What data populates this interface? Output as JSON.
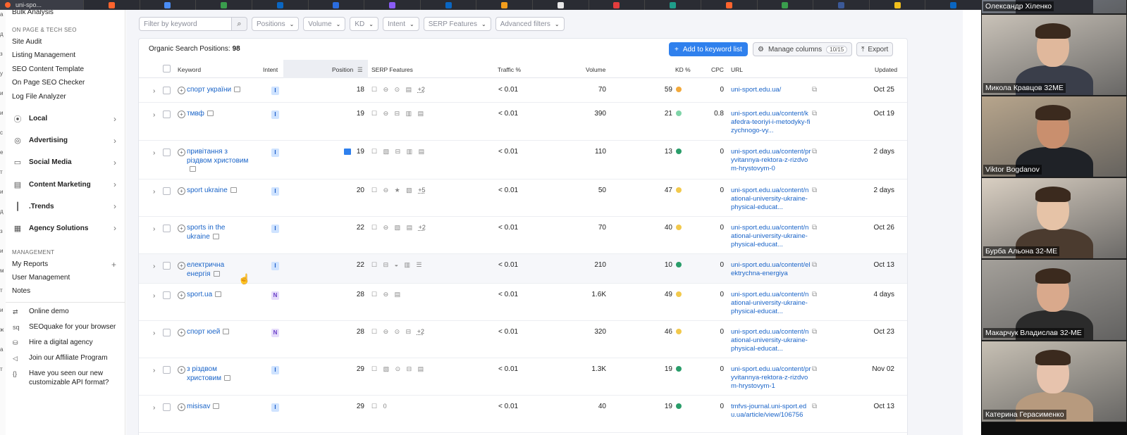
{
  "browser": {
    "active_tab_label": "uni-spo...",
    "tab_favicons": [
      {
        "icon": "generic-favicon-icon",
        "color": "#ff642d"
      },
      {
        "icon": "generic-favicon-icon",
        "color": "#4a8df6"
      },
      {
        "icon": "generic-favicon-icon",
        "color": "#3a9e4d"
      },
      {
        "icon": "linkedin-favicon-icon",
        "color": "#0a66c2"
      },
      {
        "icon": "generic-favicon-icon",
        "color": "#2b6de0"
      },
      {
        "icon": "generic-favicon-icon",
        "color": "#8a5cf6"
      },
      {
        "icon": "linkedin-favicon-icon",
        "color": "#0a66c2"
      },
      {
        "icon": "analytics-favicon-icon",
        "color": "#f29d1c"
      },
      {
        "icon": "generic-favicon-icon",
        "color": "#e8e8e8"
      },
      {
        "icon": "generic-favicon-icon",
        "color": "#e33d3d"
      },
      {
        "icon": "generic-favicon-icon",
        "color": "#1f9e8a"
      },
      {
        "icon": "generic-favicon-icon",
        "color": "#ff642d"
      },
      {
        "icon": "generic-favicon-icon",
        "color": "#3a9e4d"
      },
      {
        "icon": "generic-favicon-icon",
        "color": "#3b5998"
      },
      {
        "icon": "generic-favicon-icon",
        "color": "#f2c01c"
      },
      {
        "icon": "generic-favicon-icon",
        "color": "#0a66c2"
      }
    ]
  },
  "left_edge_glyphs": [
    "а",
    "д",
    "з",
    "у",
    "и",
    "и",
    "с",
    "е",
    "т",
    "и",
    "д",
    "з",
    "и",
    "м",
    "т",
    "и",
    "ж",
    "а",
    "т"
  ],
  "sidebar": {
    "top_link": "Bulk Analysis",
    "onpage_caption": "ON PAGE & TECH SEO",
    "onpage_links": [
      "Site Audit",
      "Listing Management",
      "SEO Content Template",
      "On Page SEO Checker",
      "Log File Analyzer"
    ],
    "sections": [
      {
        "label": "Local",
        "icon": "location-pin-icon"
      },
      {
        "label": "Advertising",
        "icon": "target-icon"
      },
      {
        "label": "Social Media",
        "icon": "chat-icon"
      },
      {
        "label": "Content Marketing",
        "icon": "document-icon"
      },
      {
        "label": ".Trends",
        "icon": "bar-chart-icon"
      },
      {
        "label": "Agency Solutions",
        "icon": "grid-icon"
      }
    ],
    "management_caption": "MANAGEMENT",
    "management_links": [
      "My Reports",
      "User Management",
      "Notes"
    ],
    "promos": [
      {
        "label": "Online demo",
        "icon": "demo-icon"
      },
      {
        "label": "SEOquake for your browser",
        "icon": "seoquake-icon"
      },
      {
        "label": "Hire a digital agency",
        "icon": "agency-icon"
      },
      {
        "label": "Join our Affiliate Program",
        "icon": "megaphone-icon"
      },
      {
        "label": "Have you seen our new customizable API format?",
        "icon": "api-braces-icon"
      }
    ]
  },
  "filters": {
    "search_placeholder": "Filter by keyword",
    "dropdowns": [
      "Positions",
      "Volume",
      "KD",
      "Intent",
      "SERP Features",
      "Advanced filters"
    ]
  },
  "panel": {
    "title": "Organic Search Positions:",
    "count": "98",
    "add_button": "Add to keyword list",
    "manage_columns": "Manage columns",
    "manage_columns_count": "10/15",
    "export": "Export"
  },
  "columns": [
    "Keyword",
    "Intent",
    "Position",
    "SERP Features",
    "Traffic %",
    "Volume",
    "KD %",
    "CPC",
    "URL",
    "Updated"
  ],
  "rows": [
    {
      "keyword": "спорт україни",
      "intent": "I",
      "position": "18",
      "serp": "☐ ⊖ ⊙ ▤",
      "serp_more": "+2",
      "traffic": "< 0.01",
      "volume": "70",
      "kd": "59",
      "kd_color": "#f2a93b",
      "cpc": "0",
      "url": "uni-sport.edu.ua/",
      "updated": "Oct 25"
    },
    {
      "keyword": "тмвф",
      "intent": "I",
      "position": "19",
      "serp": "☐ ⊖ ⊟ ▥ ▤",
      "serp_more": "",
      "traffic": "< 0.01",
      "volume": "390",
      "kd": "21",
      "kd_color": "#7fd4a8",
      "cpc": "0.8",
      "url": "uni-sport.edu.ua/content/kafedra-teoriyi-i-metodyky-fizychnogo-vy...",
      "updated": "Oct 19"
    },
    {
      "keyword": "привітання з різдвом христовим",
      "intent": "I",
      "position": "19",
      "serp": "☐ ▧ ⊟ ▥ ▤",
      "serp_more": "",
      "traffic": "< 0.01",
      "volume": "110",
      "kd": "13",
      "kd_color": "#2a9d6a",
      "cpc": "0",
      "url": "uni-sport.edu.ua/content/pryvitannya-rektora-z-rizdvom-hrystovym-0",
      "updated": "2 days"
    },
    {
      "keyword": "sport ukraine",
      "intent": "I",
      "position": "20",
      "serp": "☐ ⊖ ★ ▧",
      "serp_more": "+5",
      "traffic": "< 0.01",
      "volume": "50",
      "kd": "47",
      "kd_color": "#f2c94c",
      "cpc": "0",
      "url": "uni-sport.edu.ua/content/national-university-ukraine-physical-educat...",
      "updated": "2 days"
    },
    {
      "keyword": "sports in the ukraine",
      "intent": "I",
      "position": "22",
      "serp": "☐ ⊖ ▧ ▤",
      "serp_more": "+2",
      "traffic": "< 0.01",
      "volume": "70",
      "kd": "40",
      "kd_color": "#f2c94c",
      "cpc": "0",
      "url": "uni-sport.edu.ua/content/national-university-ukraine-physical-educat...",
      "updated": "Oct 26"
    },
    {
      "keyword": "електрична енергія",
      "intent": "I",
      "position": "22",
      "serp": "☐ ⊟ ◒ ▥ ☰",
      "serp_more": "",
      "traffic": "< 0.01",
      "volume": "210",
      "kd": "10",
      "kd_color": "#2a9d6a",
      "cpc": "0",
      "url": "uni-sport.edu.ua/content/elektrychna-energiya",
      "updated": "Oct 13"
    },
    {
      "keyword": "sport.ua",
      "intent": "N",
      "position": "28",
      "serp": "☐ ⊖ ▤",
      "serp_more": "",
      "traffic": "< 0.01",
      "volume": "1.6K",
      "kd": "49",
      "kd_color": "#f2c94c",
      "cpc": "0",
      "url": "uni-sport.edu.ua/content/national-university-ukraine-physical-educat...",
      "updated": "4 days"
    },
    {
      "keyword": "спорт юей",
      "intent": "N",
      "position": "28",
      "serp": "☐ ⊖ ⊙ ⊟",
      "serp_more": "+2",
      "traffic": "< 0.01",
      "volume": "320",
      "kd": "46",
      "kd_color": "#f2c94c",
      "cpc": "0",
      "url": "uni-sport.edu.ua/content/national-university-ukraine-physical-educat...",
      "updated": "Oct 23"
    },
    {
      "keyword": "з різдвом христовим",
      "intent": "I",
      "position": "29",
      "serp": "☐ ▧ ⊙ ⊟ ▤",
      "serp_more": "",
      "traffic": "< 0.01",
      "volume": "1.3K",
      "kd": "19",
      "kd_color": "#2a9d6a",
      "cpc": "0",
      "url": "uni-sport.edu.ua/content/pryvitannya-rektora-z-rizdvom-hrystovym-1",
      "updated": "Nov 02"
    },
    {
      "keyword": "misisav",
      "intent": "I",
      "position": "29",
      "serp": "☐ 0",
      "serp_more": "",
      "traffic": "< 0.01",
      "volume": "40",
      "kd": "19",
      "kd_color": "#2a9d6a",
      "cpc": "0",
      "url": "tmfvs-journal.uni-sport.edu.ua/article/view/106756",
      "updated": "Oct 13"
    }
  ],
  "participants": [
    {
      "name": "Олександр Хіленко",
      "bg": "#8c96a8",
      "skin": "#d8b49a",
      "shirt": "#2d2f36"
    },
    {
      "name": "Микола Кравцов 32МЕ",
      "bg": "#c9c2b8",
      "skin": "#e0b89c",
      "shirt": "#3a3e4a"
    },
    {
      "name": "Viktor Bogdanov",
      "bg": "#b7a58c",
      "skin": "#c98f6e",
      "shirt": "#1f2227"
    },
    {
      "name": "Бурба Альона 32-МЕ",
      "bg": "#d9cfc2",
      "skin": "#e6c3a7",
      "shirt": "#4b3b2f"
    },
    {
      "name": "Макарчук Владислав 32-МЕ",
      "bg": "#a4a09a",
      "skin": "#d9a98c",
      "shirt": "#2b2b2b"
    },
    {
      "name": "Катерина Герасименко",
      "bg": "#c7c0b4",
      "skin": "#e7c3ad",
      "shirt": "#b79a7e"
    }
  ]
}
